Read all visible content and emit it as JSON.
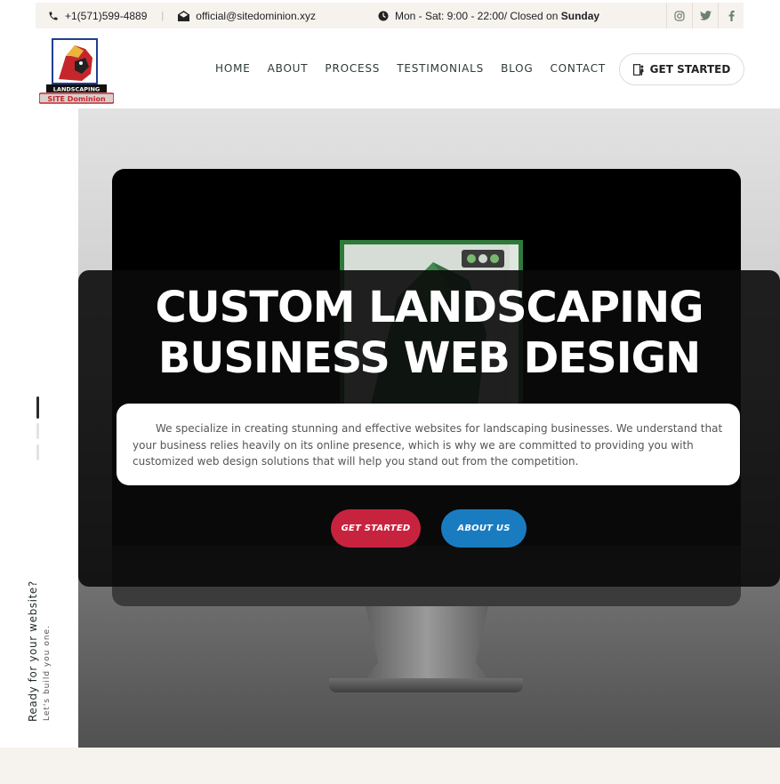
{
  "topbar": {
    "phone": "+1(571)599-4889",
    "separator": "|",
    "email": "official@sitedominion.xyz",
    "hours_prefix": "Mon - Sat: 9:00 - 22:00/ Closed on ",
    "hours_day": "Sunday",
    "social": [
      "instagram-icon",
      "twitter-icon",
      "facebook-icon"
    ],
    "social_glyphs": [
      "◎",
      "🐦",
      "f"
    ]
  },
  "logo": {
    "top_text": "LANDSCAPING",
    "bottom_text": "SITE Dominion"
  },
  "nav": {
    "items": [
      "HOME",
      "ABOUT",
      "PROCESS",
      "TESTIMONIALS",
      "BLOG",
      "CONTACT"
    ]
  },
  "header_cta": {
    "label": "GET STARTED"
  },
  "rail": {
    "title": "Ready for your website?",
    "subtitle": "Let's build you one."
  },
  "hero": {
    "title_line1": "CUSTOM LANDSCAPING",
    "title_line2": "BUSINESS WEB DESIGN",
    "description": "We specialize in creating stunning and effective websites for landscaping businesses. We understand that your business relies heavily on its online presence, which is why we are committed to providing you with customized web design solutions that will help you stand out from the competition.",
    "button_start": "GET STARTED",
    "button_about": "ABOUT US"
  },
  "colors": {
    "accent_red": "#c7233f",
    "accent_blue": "#1a7cc0",
    "topbar_bg": "#f6f3ee",
    "nav_text": "#2d3b33"
  }
}
